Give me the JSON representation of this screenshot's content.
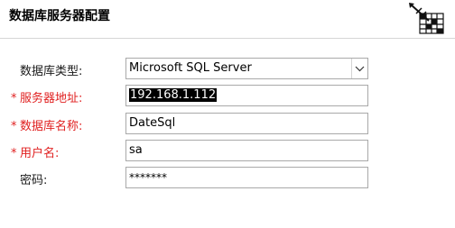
{
  "header": {
    "title": "数据库服务器配置",
    "logo_icon": "database-settings-icon"
  },
  "form": {
    "db_type": {
      "label": "数据库类型:",
      "required": false,
      "value": "Microsoft SQL Server",
      "dropdown_icon": "chevron-down-icon"
    },
    "server_address": {
      "star": "*",
      "label": "服务器地址:",
      "required": true,
      "value": "192.168.1.112",
      "text_selected": true
    },
    "db_name": {
      "star": "*",
      "label": "数据库名称:",
      "required": true,
      "value": "DateSql"
    },
    "username": {
      "star": "*",
      "label": "用户名:",
      "required": true,
      "value": "sa"
    },
    "password": {
      "label": "密码:",
      "required": false,
      "value": "*******"
    }
  },
  "colors": {
    "required_label": "#e02020",
    "field_border": "#a9a9a9",
    "selection_bg": "#000000",
    "header_divider": "#d6d6d6"
  }
}
